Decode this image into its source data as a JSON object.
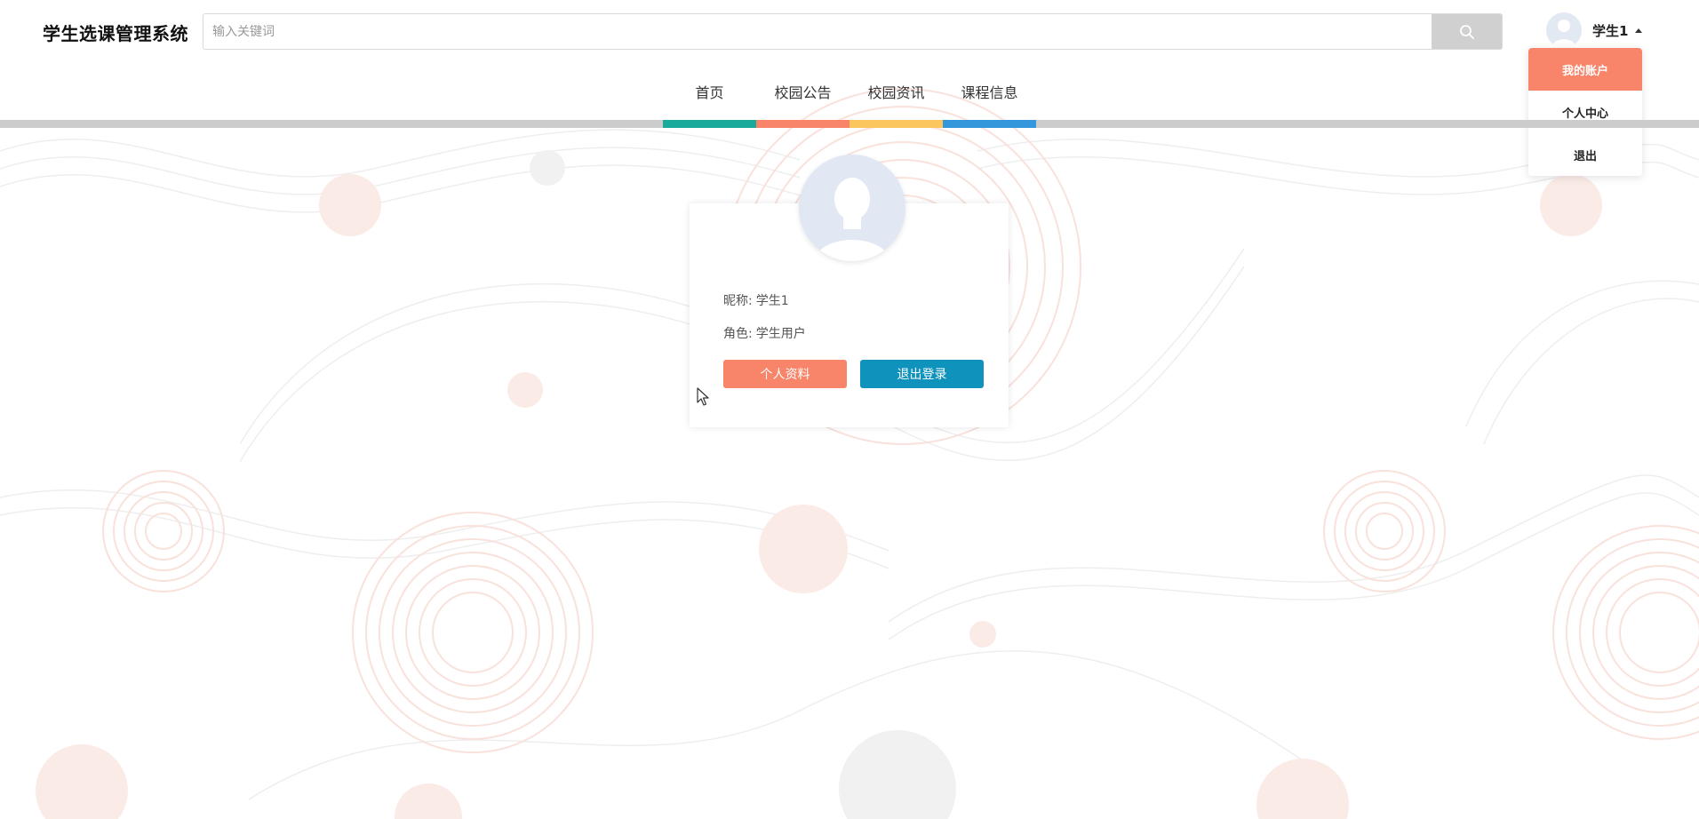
{
  "brand": {
    "title": "学生选课管理系统"
  },
  "search": {
    "placeholder": "输入关键词",
    "icon": "search-icon"
  },
  "user": {
    "name": "学生1",
    "avatar_icon": "user-avatar-icon"
  },
  "dropdown": {
    "items": [
      {
        "label": "我的账户",
        "active": true
      },
      {
        "label": "个人中心",
        "active": false
      },
      {
        "label": "退出",
        "active": false
      }
    ]
  },
  "nav": {
    "items": [
      {
        "label": "首页",
        "color": "#1aaa9c"
      },
      {
        "label": "校园公告",
        "color": "#f88469"
      },
      {
        "label": "校园资讯",
        "color": "#fcc65f"
      },
      {
        "label": "课程信息",
        "color": "#3597db"
      }
    ],
    "bar_color": "#cccccc"
  },
  "profile": {
    "nickname_label": "昵称:",
    "nickname_value": "学生1",
    "role_label": "角色:",
    "role_value": "学生用户",
    "profile_button": "个人资料",
    "logout_button": "退出登录"
  },
  "colors": {
    "accent_salmon": "#f88469",
    "accent_blue": "#0f93bd"
  }
}
